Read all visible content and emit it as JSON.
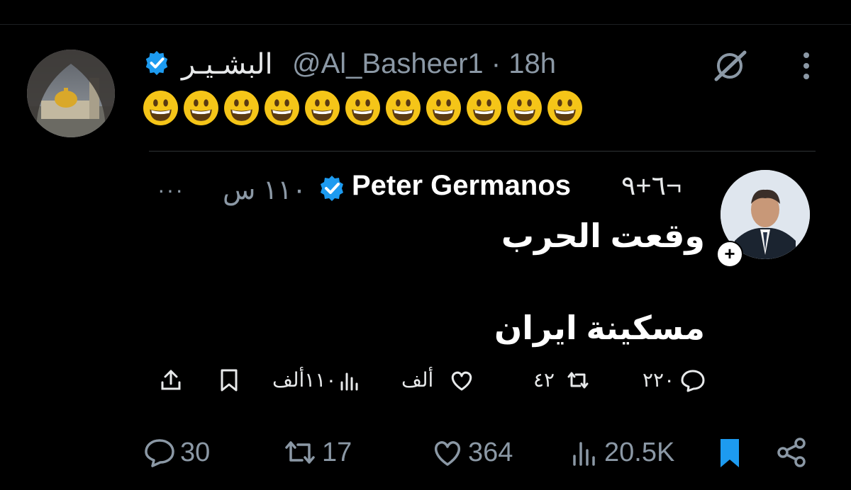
{
  "post": {
    "display_name": "البشـيـر",
    "handle": "@Al_Basheer1 · 18h",
    "emoji_count": 11,
    "emoji_name": "grinning-face"
  },
  "quote": {
    "name": "Peter Germanos",
    "name_suffix": "٦+٩¬",
    "time": "١١٠ س",
    "text_line1": "وقعت الحرب",
    "text_line2": "مسكينة ايران",
    "more": "···",
    "follow_symbol": "+",
    "actions": {
      "reply": "٢٢٠",
      "repost": "٤٢",
      "like": "ألف",
      "views": "١١٠ألف"
    }
  },
  "actions": {
    "reply": "30",
    "repost": "17",
    "like": "364",
    "views": "20.5K"
  },
  "colors": {
    "verified": "#1d9bf0",
    "bookmark_active": "#1d9bf0",
    "muted_text": "#8b98a5",
    "background": "#000000"
  }
}
